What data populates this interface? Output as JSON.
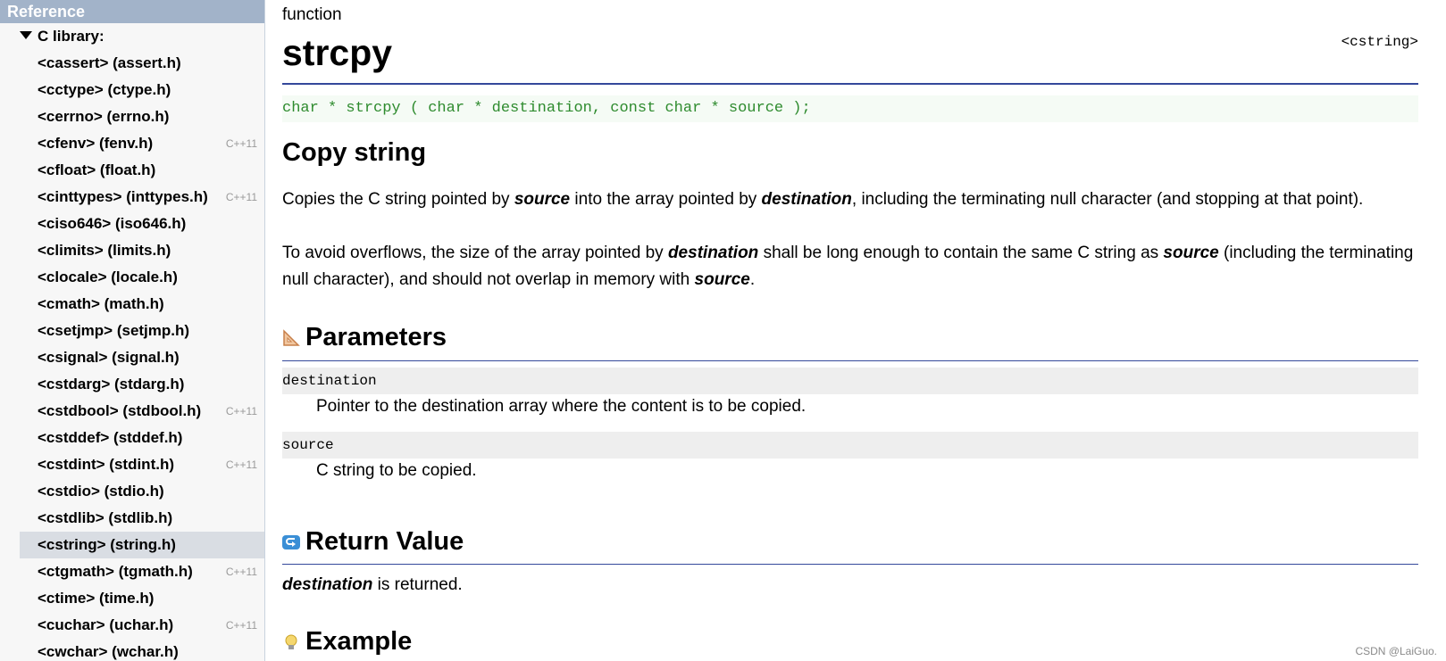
{
  "sidebar": {
    "header": "Reference",
    "root_label": "C library:",
    "items": [
      {
        "label": "<cassert> (assert.h)",
        "badge": ""
      },
      {
        "label": "<cctype> (ctype.h)",
        "badge": ""
      },
      {
        "label": "<cerrno> (errno.h)",
        "badge": ""
      },
      {
        "label": "<cfenv> (fenv.h)",
        "badge": "C++11"
      },
      {
        "label": "<cfloat> (float.h)",
        "badge": ""
      },
      {
        "label": "<cinttypes> (inttypes.h)",
        "badge": "C++11"
      },
      {
        "label": "<ciso646> (iso646.h)",
        "badge": ""
      },
      {
        "label": "<climits> (limits.h)",
        "badge": ""
      },
      {
        "label": "<clocale> (locale.h)",
        "badge": ""
      },
      {
        "label": "<cmath> (math.h)",
        "badge": ""
      },
      {
        "label": "<csetjmp> (setjmp.h)",
        "badge": ""
      },
      {
        "label": "<csignal> (signal.h)",
        "badge": ""
      },
      {
        "label": "<cstdarg> (stdarg.h)",
        "badge": ""
      },
      {
        "label": "<cstdbool> (stdbool.h)",
        "badge": "C++11"
      },
      {
        "label": "<cstddef> (stddef.h)",
        "badge": ""
      },
      {
        "label": "<cstdint> (stdint.h)",
        "badge": "C++11"
      },
      {
        "label": "<cstdio> (stdio.h)",
        "badge": ""
      },
      {
        "label": "<cstdlib> (stdlib.h)",
        "badge": ""
      },
      {
        "label": "<cstring> (string.h)",
        "badge": "",
        "selected": true
      },
      {
        "label": "<ctgmath> (tgmath.h)",
        "badge": "C++11"
      },
      {
        "label": "<ctime> (time.h)",
        "badge": ""
      },
      {
        "label": "<cuchar> (uchar.h)",
        "badge": "C++11"
      },
      {
        "label": "<cwchar> (wchar.h)",
        "badge": ""
      }
    ]
  },
  "main": {
    "kind": "function",
    "title": "strcpy",
    "header_link": "<cstring>",
    "prototype": "char * strcpy ( char * destination, const char * source );",
    "short_desc": "Copy string",
    "desc1": {
      "t1": "Copies the C string pointed by ",
      "e1": "source",
      "t2": " into the array pointed by ",
      "e2": "destination",
      "t3": ", including the terminating null character (and stopping at that point)."
    },
    "desc2": {
      "t1": "To avoid overflows, the size of the array pointed by ",
      "e1": "destination",
      "t2": " shall be long enough to contain the same C string as ",
      "e2": "source",
      "t3": " (including the terminating null character), and should not overlap in memory with ",
      "e3": "source",
      "t4": "."
    },
    "params_title": "Parameters",
    "params": [
      {
        "name": "destination",
        "desc": "Pointer to the destination array where the content is to be copied."
      },
      {
        "name": "source",
        "desc": "C string to be copied."
      }
    ],
    "return_title": "Return Value",
    "return_text": {
      "e1": "destination",
      "t1": " is returned."
    },
    "example_title": "Example"
  },
  "watermark": "CSDN @LaiGuo.",
  "colors": {
    "sidebar_header": "#a2b3c9",
    "rule": "#34489b",
    "prototype_text": "#2e8b2e",
    "selected_item": "#d9dde3"
  }
}
